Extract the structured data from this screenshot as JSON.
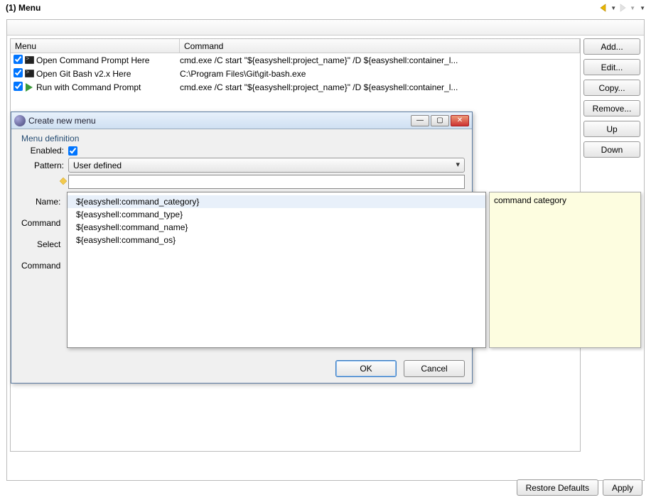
{
  "window": {
    "title": "(1) Menu"
  },
  "nav": {
    "back_color": "#e8b700",
    "fwd_color": "#bbbbbb"
  },
  "table": {
    "headers": {
      "menu": "Menu",
      "command": "Command"
    },
    "rows": [
      {
        "checked": true,
        "icon": "term",
        "menu": "Open Command Prompt Here",
        "cmd": "cmd.exe /C start \"${easyshell:project_name}\" /D ${easyshell:container_l..."
      },
      {
        "checked": true,
        "icon": "term",
        "menu": "Open Git Bash v2.x Here",
        "cmd": "C:\\Program Files\\Git\\git-bash.exe"
      },
      {
        "checked": true,
        "icon": "run",
        "menu": "Run with Command Prompt",
        "cmd": "cmd.exe /C start \"${easyshell:project_name}\" /D ${easyshell:container_l..."
      }
    ]
  },
  "side_buttons": {
    "add": "Add...",
    "edit": "Edit...",
    "copy": "Copy...",
    "remove": "Remove...",
    "up": "Up",
    "down": "Down"
  },
  "dialog": {
    "title": "Create new menu",
    "section": "Menu definition",
    "enabled_label": "Enabled:",
    "enabled_checked": true,
    "pattern_label": "Pattern:",
    "pattern_value": "User defined",
    "pattern_input": "",
    "labels": {
      "name": "Name:",
      "command": "Command",
      "select": "Select",
      "command2": "Command"
    },
    "ok": "OK",
    "cancel": "Cancel"
  },
  "autocomplete": {
    "items": [
      "${easyshell:command_category}",
      "${easyshell:command_type}",
      "${easyshell:command_name}",
      "${easyshell:command_os}"
    ]
  },
  "tooltip": {
    "text": "command category"
  },
  "footer": {
    "restore": "Restore Defaults",
    "apply": "Apply"
  }
}
